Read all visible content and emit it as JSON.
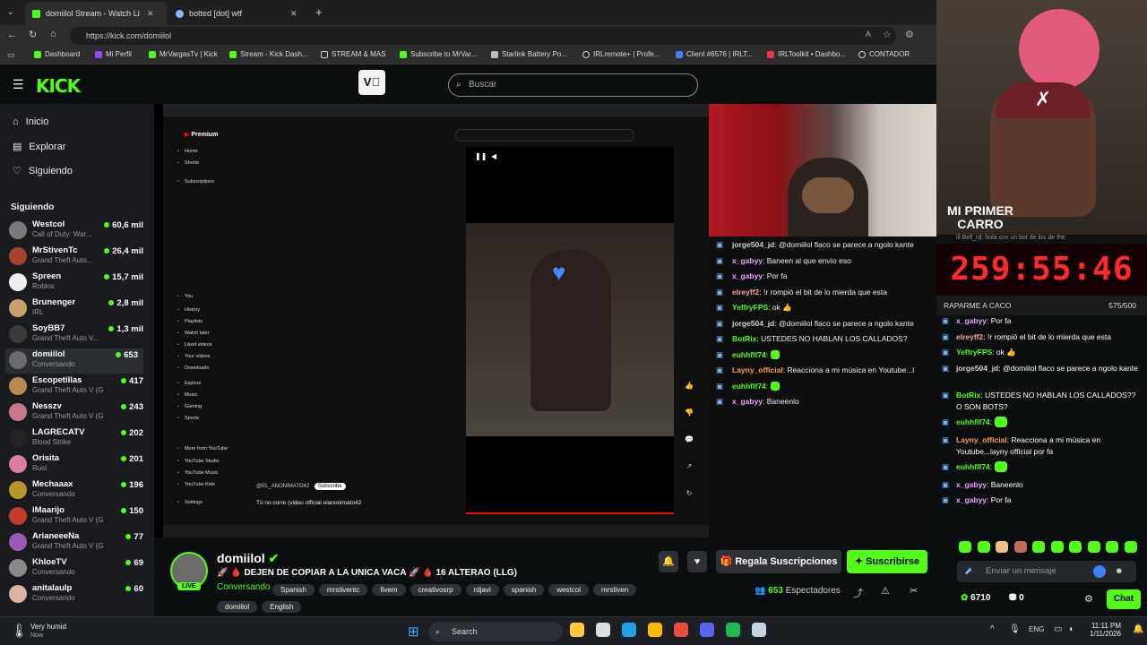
{
  "browser": {
    "tabs": [
      {
        "label": "domiilol Stream - Watch Live"
      },
      {
        "label": "botted [dot] wtf"
      }
    ],
    "url": "https://kick.com/domiilol",
    "bookmarks": [
      "Dashboard",
      "Mi Perfil",
      "MrVargasTv | Kick",
      "Stream - Kick Dash...",
      "STREAM & MAS",
      "Subscribe to MrVar...",
      "Starlink Battery Po...",
      "IRLremote+ | Profe...",
      "Client #6576 | IRLT...",
      "IRLToolkit • Dashbo...",
      "CONTADOR"
    ]
  },
  "kick": {
    "search_placeholder": "Buscar",
    "nav": [
      {
        "label": "Inicio",
        "icon": "home-icon"
      },
      {
        "label": "Explorar",
        "icon": "browse-icon"
      },
      {
        "label": "Siguiendo",
        "icon": "heart-icon"
      }
    ],
    "following_title": "Siguiendo",
    "following": [
      {
        "name": "Westcol",
        "game": "Call of Duty: War...",
        "viewers": "60,6 mil"
      },
      {
        "name": "MrStivenTc",
        "game": "Grand Theft Auto...",
        "viewers": "26,4 mil"
      },
      {
        "name": "Spreen",
        "game": "Roblox",
        "viewers": "15,7 mil"
      },
      {
        "name": "Brunenger",
        "game": "IRL",
        "viewers": "2,8 mil"
      },
      {
        "name": "SoyBB7",
        "game": "Grand Theft Auto V...",
        "viewers": "1,3 mil"
      },
      {
        "name": "domiilol",
        "game": "Conversando",
        "viewers": "653"
      },
      {
        "name": "Escopetillas",
        "game": "Grand Theft Auto V (G...",
        "viewers": "417"
      },
      {
        "name": "Nesszv",
        "game": "Grand Theft Auto V (G...",
        "viewers": "243"
      },
      {
        "name": "LAGRECATV",
        "game": "Blood Strike",
        "viewers": "202"
      },
      {
        "name": "Orisita",
        "game": "Rust",
        "viewers": "201"
      },
      {
        "name": "Mechaaax",
        "game": "Conversando",
        "viewers": "196"
      },
      {
        "name": "iMaarijo",
        "game": "Grand Theft Auto V (G...",
        "viewers": "150"
      },
      {
        "name": "ArianeeeNa",
        "game": "Grand Theft Auto V (GTA)",
        "viewers": "77"
      },
      {
        "name": "KhloeTV",
        "game": "Conversando",
        "viewers": "69"
      },
      {
        "name": "anitalaulp",
        "game": "Conversando",
        "viewers": "60"
      }
    ]
  },
  "stream_overlay_chat": [
    {
      "user": "jorge504_jd",
      "text": "@domiilol flaco se parece a ngolo kante",
      "color": "#cfcfcf"
    },
    {
      "user": "x_gabyy",
      "text": "Baneen al que envío eso",
      "color": "#e9a0ff"
    },
    {
      "user": "x_gabyy",
      "text": "Por fa",
      "color": "#e9a0ff"
    },
    {
      "user": "elreyff2",
      "text": "!r rompió el bit de lo mierda que esta",
      "color": "#ff9fa0"
    },
    {
      "user": "YeffryFPS",
      "text": "ok 👍",
      "color": "#53fc18"
    },
    {
      "user": "jorge504_jd",
      "text": "@domiilol flaco se parece a ngolo kante",
      "color": "#cfcfcf"
    },
    {
      "user": "BotRix",
      "text": "USTEDES NO HABLAN LOS CALLADOS?",
      "color": "#53fc18"
    },
    {
      "user": "euhhflf74",
      "text": "",
      "color": "#53fc18"
    },
    {
      "user": "Layny_official",
      "text": "Reacciona a mi música en Youtube...l",
      "color": "#ff9f4a"
    },
    {
      "user": "euhhflf74",
      "text": "",
      "color": "#53fc18"
    },
    {
      "user": "x_gabyy",
      "text": "Baneenlo",
      "color": "#e9a0ff"
    }
  ],
  "youtube": {
    "menu": [
      "Home",
      "Shorts",
      "Subscriptions",
      "You",
      "History",
      "Playlists",
      "Watch later",
      "Liked videos",
      "Your videos",
      "Downloads",
      "Explore",
      "Music",
      "Gaming",
      "Sports",
      "More from YouTube",
      "YouTube Studio",
      "YouTube Music",
      "YouTube Kids",
      "Settings"
    ],
    "channel": "@EL_ANONIMATO42",
    "subscribe": "Subscribe",
    "title": "Tú no corre (video official elanonimato42"
  },
  "channel": {
    "name": "domiilol",
    "live_badge": "LIVE",
    "title": "🚀 🩸 DEJEN DE COPIAR A LA UNICA VACA 🚀 🩸 16 ALTERAO (LLG)",
    "category": "Conversando",
    "tags": [
      "Spanish",
      "mrstiventc",
      "fivem",
      "creativosrp",
      "rdjavi",
      "spanish",
      "westcol",
      "mrstiven",
      "domiilol",
      "English"
    ],
    "gift_label": "Regala Suscripciones",
    "subscribe_label": "Suscribirse",
    "viewers": "653",
    "viewers_label": "Espectadores"
  },
  "overlay": {
    "sign_line1": "MI PRIMER",
    "sign_line2": "CARRO",
    "ticker": "ill Bell_rd: hola sov un bot  de los de the",
    "timer": "259:55:46",
    "goal_label": "RAPARME A CACO",
    "goal_count": "575/500"
  },
  "chat": {
    "messages": [
      {
        "user": "x_gabyy",
        "text": "Por fa",
        "color": "#e9a0ff"
      },
      {
        "user": "elreyff2",
        "text": "!r rompió el bit de lo mierda que esta",
        "color": "#ff9fa0"
      },
      {
        "user": "YeffryFPS",
        "text": "ok 👍",
        "color": "#53fc18"
      },
      {
        "user": "jorge504_jd",
        "text": "@domiilol flaco se parece a ngolo kante",
        "color": "#cfcfcf"
      },
      {
        "user": "BotRix",
        "text": "USTEDES NO HABLAN LOS CALLADOS?? O SON BOTS?",
        "color": "#53fc18"
      },
      {
        "user": "euhhflf74",
        "text": "",
        "color": "#53fc18"
      },
      {
        "user": "Layny_official",
        "text": "Reacciona a mi música en Youtube...layny official por fa",
        "color": "#ff9f4a"
      },
      {
        "user": "euhhflf74",
        "text": "",
        "color": "#53fc18"
      },
      {
        "user": "x_gabyy",
        "text": "Baneenlo",
        "color": "#e9a0ff"
      },
      {
        "user": "x_gabyy",
        "text": "Por fa",
        "color": "#e9a0ff"
      }
    ],
    "input_placeholder": "Enviar un mensaje",
    "points": "6710",
    "items": "0",
    "chat_button": "Chat"
  },
  "taskbar": {
    "weather": "Very humid",
    "weather_sub": "Now",
    "search": "Search",
    "lang": "ENG",
    "time": "11:11 PM",
    "date": "1/11/2026"
  },
  "colors": {
    "kick_green": "#53fc18",
    "timer_red": "#ff2b2b"
  }
}
